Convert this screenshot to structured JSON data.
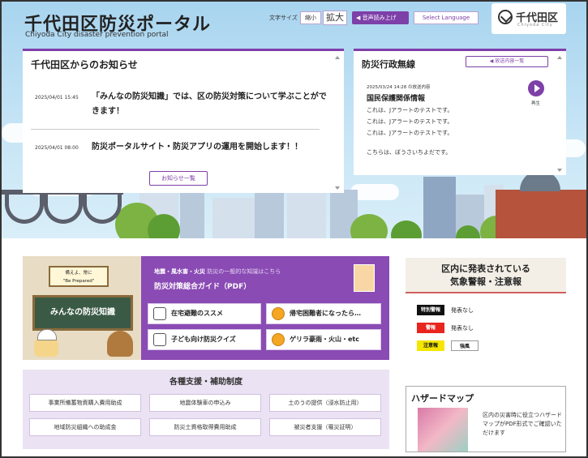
{
  "header": {
    "title": "千代田区防災ポータル",
    "subtitle": "Chiyoda City disaster prevention portal",
    "font_size_label": "文字サイズ",
    "font_small": "縮小",
    "font_large": "拡大",
    "read_aloud": "音声読み上げ",
    "language": "Select Language",
    "logo_text": "千代田区",
    "logo_sub": "Chiyoda City"
  },
  "news": {
    "title": "千代田区からのお知らせ",
    "items": [
      {
        "date": "2025/04/01 15:45",
        "text": "「みんなの防災知識」では、区の防災対策について学ぶことができます！"
      },
      {
        "date": "2025/04/01 08:00",
        "text": "防災ポータルサイト・防災アプリの運用を開始します！！"
      }
    ],
    "more_label": "お知らせ一覧"
  },
  "radio": {
    "title": "防災行政無線",
    "list_label": "放送内容一覧",
    "meta": "2025/03/24 14:28 の放送内容",
    "item_title": "国民保護関係情報",
    "lines": [
      "これは、Jアラートのテストです。",
      "これは、Jアラートのテストです。",
      "これは、Jアラートのテストです。"
    ],
    "closing": "こちらは、ぼうさいちよだです。",
    "play_label": "再生"
  },
  "knowledge": {
    "sign_line1": "備えよ、常に",
    "sign_line2": "\"Be Prepared\"",
    "board_text": "みんなの防災知識"
  },
  "guide": {
    "top_bold": "地震・風水害・火災",
    "top_lite": "防災の一般的な知識はこちら",
    "main": "防災対策総合ガイド（PDF）",
    "cells": [
      "在宅避難のススメ",
      "帰宅困難者になったら…",
      "子ども向け防災クイズ",
      "ゲリラ豪雨・火山・etc"
    ]
  },
  "warnings": {
    "title_line1": "区内に発表されている",
    "title_line2": "気象警報・注意報",
    "rows": [
      {
        "tag": "特別警報",
        "bg": "#111111",
        "fg": "#ffffff",
        "text": "発表なし"
      },
      {
        "tag": "警報",
        "bg": "#e8251f",
        "fg": "#ffffff",
        "text": "発表なし"
      },
      {
        "tag": "注意報",
        "bg": "#f5e600",
        "fg": "#111111",
        "text": ""
      },
      {
        "tag": "強風",
        "bg": "#ffffff",
        "fg": "#111111",
        "text": ""
      }
    ]
  },
  "support": {
    "title": "各種支援・補助制度",
    "buttons": [
      "事業所備蓄物資購入費用助成",
      "地震体験車の申込み",
      "土のうの提供（浸水防止用）",
      "地域防災組織への助成金",
      "防災士資格取得費用助成",
      "被災者支援（罹災証明）"
    ]
  },
  "hazard": {
    "title": "ハザードマップ",
    "desc": "区内の災害時に役立つハザードマップがPDF形式でご確認いただけます"
  },
  "colors": {
    "accent": "#7d3fa8",
    "guide_bg": "#8a4bb4",
    "support_bg": "#ebe2f3"
  }
}
